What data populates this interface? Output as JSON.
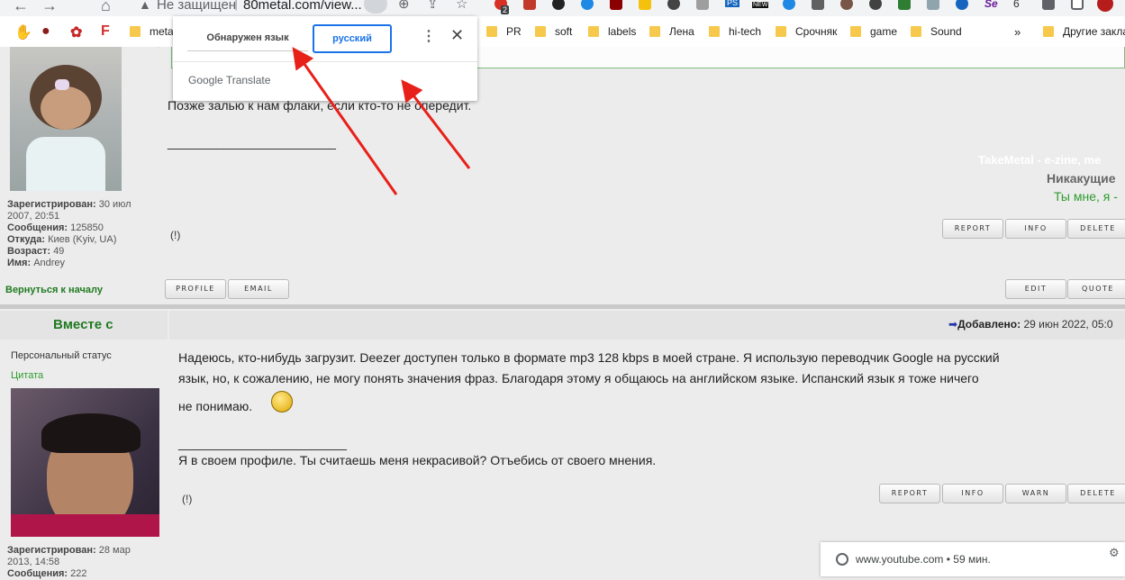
{
  "browser": {
    "security_label": "Не защищен",
    "url": "80metal.com/view...",
    "bookmarks": [
      "metal",
      "PR",
      "soft",
      "labels",
      "Лена",
      "hi-tech",
      "Срочняк",
      "game",
      "Sound",
      "Другие заклад"
    ],
    "ext_badge": "2",
    "ext_label_ps": "PS",
    "ext_label_new": "NEW",
    "ext_label_se": "Se",
    "ext_label_6": "6",
    "overflow": "»"
  },
  "translate": {
    "tab_detected": "Обнаружен язык",
    "tab_target": "русский",
    "brand": "Google Translate",
    "menu_icon": "⋮",
    "close_icon": "✕"
  },
  "post1": {
    "text": "Позже залью к нам флаки, если кто-то не опередит.",
    "sig_line": "________________________",
    "registered_label": "Зарегистрирован:",
    "registered_value": "30 июл",
    "registered_value2": "2007, 20:51",
    "messages_label": "Сообщения:",
    "messages_value": "125850",
    "from_label": "Откуда:",
    "from_value": "Киев (Kyiv, UA)",
    "age_label": "Возраст:",
    "age_value": "49",
    "name_label": "Имя:",
    "name_value": "Andrey",
    "sig_takemetal": "TakeMetal - e-zine, me",
    "sig_nikakushie": "Никакущие",
    "sig_tymne": "Ты мне, я -",
    "report_flag": "(!)",
    "btn_report": "REPORT",
    "btn_info": "INFO",
    "btn_delete": "DELETE",
    "back_to_top": "Вернуться к началу",
    "btn_profile": "PROFILE",
    "btn_email": "EMAIL",
    "btn_edit": "EDIT",
    "btn_quote": "QUOTE"
  },
  "post2": {
    "author": "Вместе с",
    "added_label": "Добавлено:",
    "added_value": "29 июн 2022, 05:0",
    "status_label": "Персональный статус",
    "quote_link": "Цитата",
    "text_line1": "Надеюсь, кто-нибудь загрузит. Deezer доступен только в формате mp3 128 kbps в моей стране. Я использую переводчик Google на русский",
    "text_line2": "язык, но, к сожалению, не могу понять значения фраз. Благодаря этому я общаюсь на английском языке. Испанский язык я тоже ничего",
    "text_line3": "не понимаю.",
    "sig_line": "________________________",
    "sig_text": "Я в своем профиле. Ты считаешь меня некрасивой? Отъебись от своего мнения.",
    "report_flag": "(!)",
    "registered_label": "Зарегистрирован:",
    "registered_value": "28 мар",
    "registered_value2": "2013, 14:58",
    "messages_label": "Сообщения:",
    "messages_value": "222",
    "btn_report": "REPORT",
    "btn_info": "INFO",
    "btn_warn": "WARN",
    "btn_delete": "DELETE"
  },
  "notification": {
    "source": "www.youtube.com",
    "time": "• 59 мин."
  },
  "colors": {
    "accent_blue": "#1a73e8",
    "forum_green": "#207a20",
    "arrow_red": "#e8201a"
  }
}
